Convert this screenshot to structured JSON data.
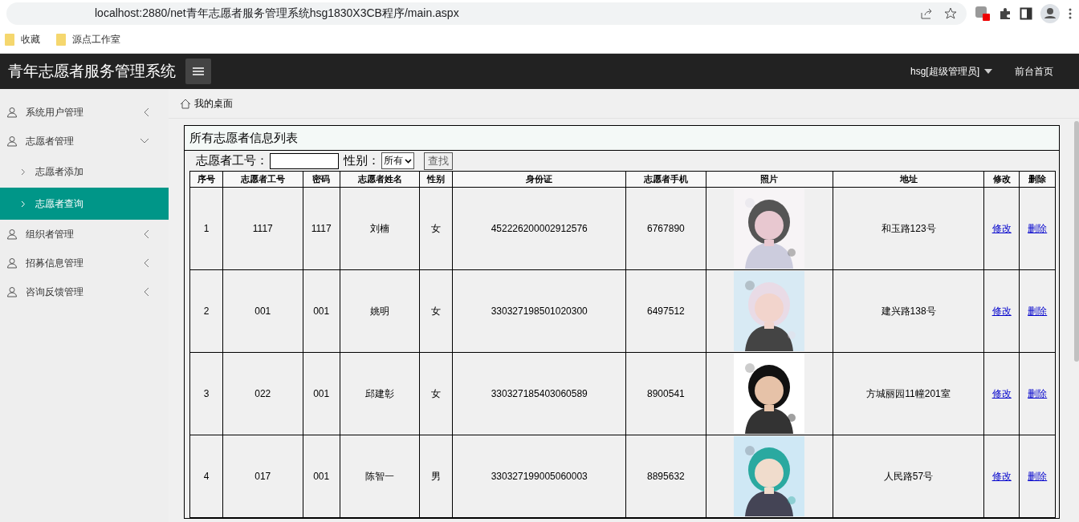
{
  "browser": {
    "url": "localhost:2880/net青年志愿者服务管理系统hsg1830X3CB程序/main.aspx",
    "bookmarks": [
      "收藏",
      "源点工作室"
    ]
  },
  "header": {
    "title": "青年志愿者服务管理系统",
    "user_menu": "hsg[超级管理员]",
    "front_link": "前台首页"
  },
  "sidebar": {
    "items": [
      {
        "label": "系统用户管理",
        "selected": false,
        "expanded": false
      },
      {
        "label": "志愿者管理",
        "selected": false,
        "expanded": true,
        "children": [
          {
            "label": "志愿者添加",
            "selected": false
          },
          {
            "label": "志愿者查询",
            "selected": true
          }
        ]
      },
      {
        "label": "组织者管理",
        "selected": false,
        "expanded": false
      },
      {
        "label": "招募信息管理",
        "selected": false,
        "expanded": false
      },
      {
        "label": "咨询反馈管理",
        "selected": false,
        "expanded": false
      }
    ]
  },
  "breadcrumb": "我的桌面",
  "panel": {
    "title": "所有志愿者信息列表",
    "search": {
      "id_label": "志愿者工号：",
      "gender_label": "性别：",
      "gender_value": "所有",
      "button": "查找"
    },
    "table": {
      "columns": [
        "序号",
        "志愿者工号",
        "密码",
        "志愿者姓名",
        "性别",
        "身份证",
        "志愿者手机",
        "照片",
        "地址",
        "修改",
        "删除"
      ],
      "rows": [
        {
          "cells": [
            "1",
            "1117",
            "1117",
            "刘楠",
            "女",
            "452226200002912576",
            "6767890"
          ],
          "address": "和玉路123号",
          "edit": "修改",
          "delete": "删除"
        },
        {
          "cells": [
            "2",
            "001",
            "001",
            "姚明",
            "女",
            "330327198501020300",
            "6497512"
          ],
          "address": "建兴路138号",
          "edit": "修改",
          "delete": "删除"
        },
        {
          "cells": [
            "3",
            "022",
            "001",
            "邱建彰",
            "女",
            "330327185403060589",
            "8900541"
          ],
          "address": "方城丽园11幢201室",
          "edit": "修改",
          "delete": "删除"
        },
        {
          "cells": [
            "4",
            "017",
            "001",
            "陈智一",
            "男",
            "330327199005060003",
            "8895632"
          ],
          "address": "人民路57号",
          "edit": "修改",
          "delete": "删除"
        }
      ]
    }
  }
}
